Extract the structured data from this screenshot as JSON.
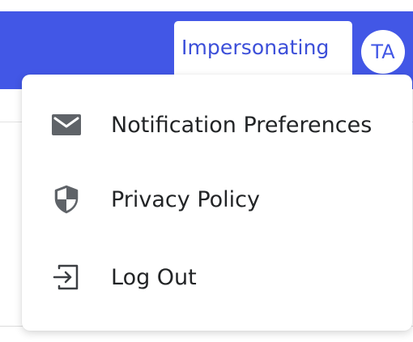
{
  "header": {
    "impersonating_label": "Impersonating",
    "avatar_initials": "TA",
    "background_color": "#4257e6"
  },
  "user_menu": {
    "items": [
      {
        "label": "Notification Preferences",
        "icon": "envelope-icon"
      },
      {
        "label": "Privacy Policy",
        "icon": "shield-icon"
      },
      {
        "label": "Log Out",
        "icon": "logout-icon"
      }
    ]
  }
}
